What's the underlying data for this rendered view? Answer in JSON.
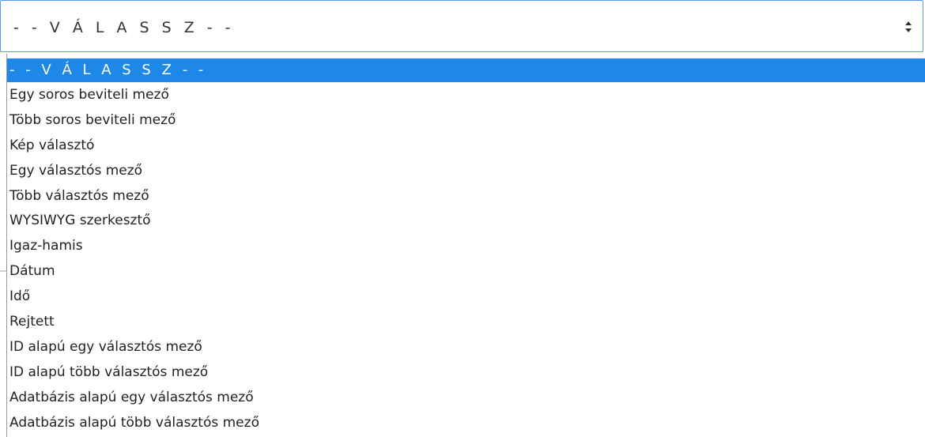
{
  "select": {
    "value": "- - V Á L A S S Z - -"
  },
  "options": [
    {
      "label": "- - V Á L A S S Z - -"
    },
    {
      "label": "Egy soros beviteli mező"
    },
    {
      "label": "Több soros beviteli mező"
    },
    {
      "label": "Kép választó"
    },
    {
      "label": "Egy választós mező"
    },
    {
      "label": "Több választós mező"
    },
    {
      "label": "WYSIWYG szerkesztő"
    },
    {
      "label": "Igaz-hamis"
    },
    {
      "label": "Dátum"
    },
    {
      "label": "Idő"
    },
    {
      "label": "Rejtett"
    },
    {
      "label": "ID alapú egy választós mező"
    },
    {
      "label": "ID alapú több választós mező"
    },
    {
      "label": "Adatbázis alapú egy választós mező"
    },
    {
      "label": "Adatbázis alapú több választós mező"
    }
  ],
  "colors": {
    "focus_border": "#5b96f0",
    "selected_background": "#1e88e8",
    "selected_text": "#ffffff",
    "option_text": "#222222"
  },
  "icons": {
    "select_arrows": "up-down-arrows-icon"
  }
}
